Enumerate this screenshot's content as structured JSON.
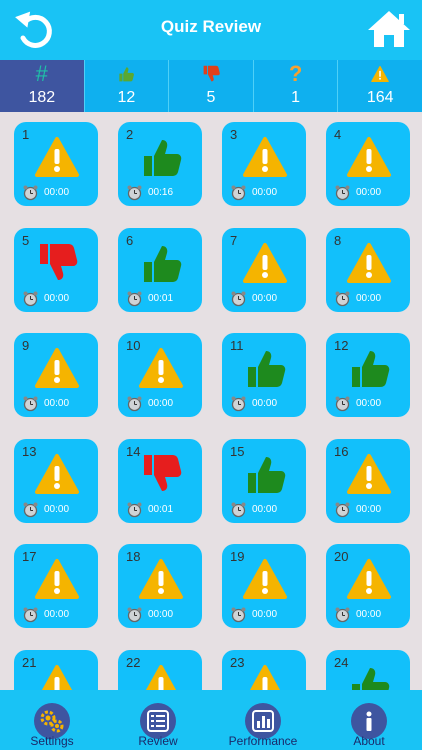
{
  "header": {
    "title": "Quiz Review"
  },
  "stats": [
    {
      "symbol": "#",
      "icon": "hash-icon",
      "value": "182",
      "active": true
    },
    {
      "icon": "thumbs-up-icon",
      "value": "12"
    },
    {
      "icon": "thumbs-down-icon",
      "value": "5"
    },
    {
      "symbol": "?",
      "icon": "question-icon",
      "value": "1"
    },
    {
      "icon": "warning-icon",
      "value": "164"
    }
  ],
  "questions": [
    {
      "num": "1",
      "status": "warning",
      "time": "00:00"
    },
    {
      "num": "2",
      "status": "correct",
      "time": "00:16"
    },
    {
      "num": "3",
      "status": "warning",
      "time": "00:00"
    },
    {
      "num": "4",
      "status": "warning",
      "time": "00:00"
    },
    {
      "num": "5",
      "status": "wrong",
      "time": "00:00"
    },
    {
      "num": "6",
      "status": "correct",
      "time": "00:01"
    },
    {
      "num": "7",
      "status": "warning",
      "time": "00:00"
    },
    {
      "num": "8",
      "status": "warning",
      "time": "00:00"
    },
    {
      "num": "9",
      "status": "warning",
      "time": "00:00"
    },
    {
      "num": "10",
      "status": "warning",
      "time": "00:00"
    },
    {
      "num": "11",
      "status": "correct",
      "time": "00:00"
    },
    {
      "num": "12",
      "status": "correct",
      "time": "00:00"
    },
    {
      "num": "13",
      "status": "warning",
      "time": "00:00"
    },
    {
      "num": "14",
      "status": "wrong",
      "time": "00:01"
    },
    {
      "num": "15",
      "status": "correct",
      "time": "00:00"
    },
    {
      "num": "16",
      "status": "warning",
      "time": "00:00"
    },
    {
      "num": "17",
      "status": "warning",
      "time": "00:00"
    },
    {
      "num": "18",
      "status": "warning",
      "time": "00:00"
    },
    {
      "num": "19",
      "status": "warning",
      "time": "00:00"
    },
    {
      "num": "20",
      "status": "warning",
      "time": "00:00"
    },
    {
      "num": "21",
      "status": "warning",
      "time": ""
    },
    {
      "num": "22",
      "status": "warning",
      "time": ""
    },
    {
      "num": "23",
      "status": "warning",
      "time": ""
    },
    {
      "num": "24",
      "status": "correct",
      "time": ""
    }
  ],
  "tabs": [
    {
      "label": "Settings",
      "icon": "gear-icon"
    },
    {
      "label": "Review",
      "icon": "list-icon"
    },
    {
      "label": "Performance",
      "icon": "bar-chart-icon"
    },
    {
      "label": "About",
      "icon": "info-icon"
    }
  ],
  "colors": {
    "bar": "#19c3f5",
    "card": "#12c0fb",
    "active": "#3e55a0",
    "correct": "#1e8a1e",
    "wrong": "#e61e1e",
    "warning": "#f5b400"
  }
}
